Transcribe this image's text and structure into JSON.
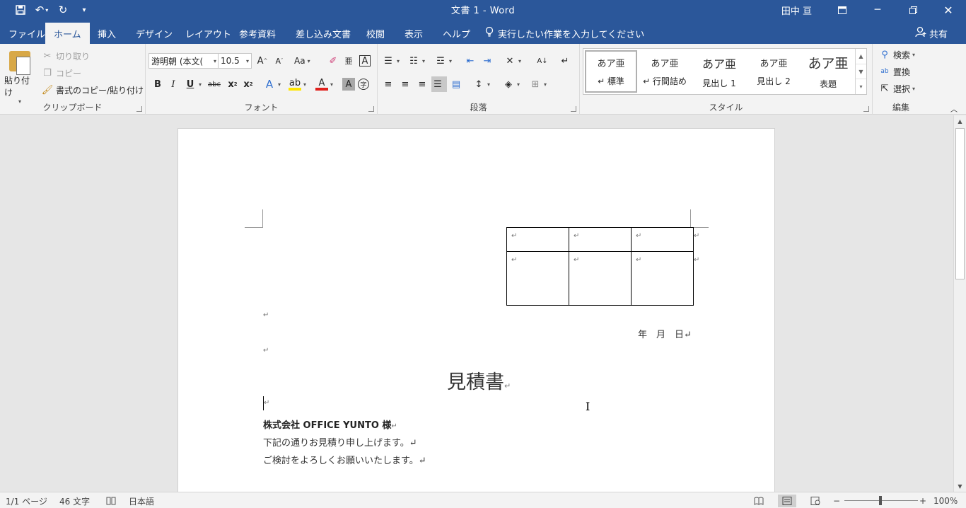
{
  "titlebar": {
    "title": "文書 1  -  Word",
    "user": "田中 亘"
  },
  "tabs": [
    {
      "label": "ファイル"
    },
    {
      "label": "ホーム"
    },
    {
      "label": "挿入"
    },
    {
      "label": "デザイン"
    },
    {
      "label": "レイアウト"
    },
    {
      "label": "参考資料"
    },
    {
      "label": "差し込み文書"
    },
    {
      "label": "校閲"
    },
    {
      "label": "表示"
    },
    {
      "label": "ヘルプ"
    }
  ],
  "tell_me": "実行したい作業を入力してください",
  "share": "共有",
  "clipboard": {
    "paste": "貼り付け",
    "cut": "切り取り",
    "copy": "コピー",
    "format_painter": "書式のコピー/貼り付け",
    "label": "クリップボード"
  },
  "font": {
    "name": "游明朝 (本文(",
    "size": "10.5",
    "case_btn": "Aa",
    "label": "フォント"
  },
  "paragraph": {
    "label": "段落"
  },
  "styles": {
    "items": [
      {
        "sample": "あア亜",
        "name": "↵ 標準"
      },
      {
        "sample": "あア亜",
        "name": "↵ 行間詰め"
      },
      {
        "sample": "あア亜",
        "name": "見出し 1"
      },
      {
        "sample": "あア亜",
        "name": "見出し 2"
      },
      {
        "sample": "あア亜",
        "name": "表題"
      }
    ],
    "label": "スタイル"
  },
  "editing": {
    "find": "検索",
    "replace": "置換",
    "select": "選択",
    "label": "編集"
  },
  "document": {
    "table_mark": "↵",
    "date_line": "年　月　日↵",
    "title": "見積書",
    "title_mark": "↵",
    "para_mark": "↵",
    "recipient": "株式会社 OFFICE YUNTO 様",
    "recipient_mark": "↵",
    "line1": "下記の通りお見積り申し上げます。↵",
    "line2": "ご検討をよろしくお願いいたします。↵"
  },
  "status": {
    "page": "1/1 ページ",
    "words": "46 文字",
    "language": "日本語",
    "zoom_minus": "−",
    "zoom_plus": "+",
    "zoom": "100%"
  }
}
